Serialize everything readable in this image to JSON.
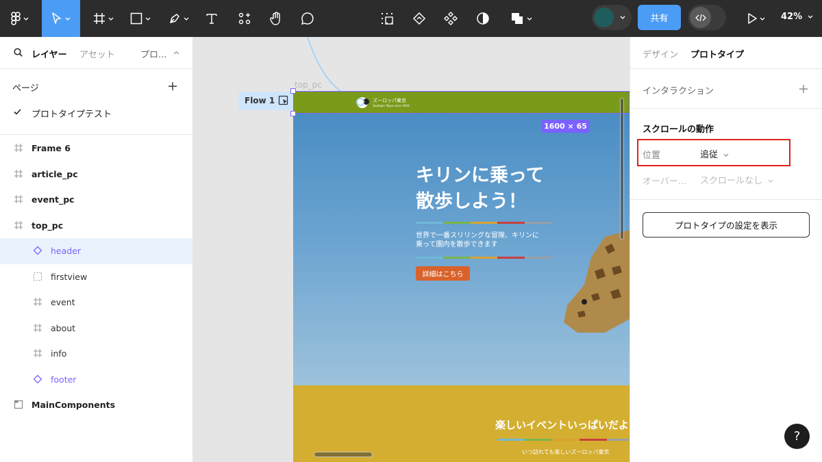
{
  "toolbar": {
    "share_label": "共有",
    "zoom_label": "42%"
  },
  "left_panel": {
    "tabs": {
      "layers": "レイヤー",
      "assets": "アセット",
      "proto": "プロ..."
    },
    "pages_label": "ページ",
    "current_page": "プロトタイプテスト",
    "layers": [
      {
        "label": "Frame 6",
        "icon": "frame-icon",
        "level": 0
      },
      {
        "label": "article_pc",
        "icon": "frame-icon",
        "level": 0
      },
      {
        "label": "event_pc",
        "icon": "frame-icon",
        "level": 0
      },
      {
        "label": "top_pc",
        "icon": "frame-icon",
        "level": 0
      },
      {
        "label": "header",
        "icon": "component-instance-icon",
        "level": 1,
        "selected": true
      },
      {
        "label": "firstview",
        "icon": "dashed-frame-icon",
        "level": 1
      },
      {
        "label": "event",
        "icon": "frame-icon",
        "level": 1
      },
      {
        "label": "about",
        "icon": "frame-icon",
        "level": 1
      },
      {
        "label": "info",
        "icon": "frame-icon",
        "level": 1
      },
      {
        "label": "footer",
        "icon": "component-instance-icon",
        "level": 1
      },
      {
        "label": "MainComponents",
        "icon": "section-icon",
        "level": 0
      }
    ]
  },
  "canvas": {
    "frame_label": "top_pc",
    "flow_label": "Flow 1",
    "size_badge": "1600 × 65",
    "site": {
      "logo_title": "ズーロッパ東京",
      "logo_sub": "Zootopia Tokyo since 19XX",
      "hero_title_line1": "キリンに乗って",
      "hero_title_line2": "散歩しよう！",
      "hero_text_line1": "世界で一番スリリングな冒険、キリンに",
      "hero_text_line2": "乗って園内を散歩できます",
      "hero_button": "詳細はこちら",
      "event_title": "楽しいイベントいっぱいだよ",
      "event_sub": "いつ訪れても楽しいズーロッパ東京"
    },
    "stripe_colors": [
      "#6fb8d8",
      "#7ab648",
      "#d9a233",
      "#c94040",
      "#9aa0a6"
    ]
  },
  "right_panel": {
    "tabs": {
      "design": "デザイン",
      "prototype": "プロトタイプ"
    },
    "interaction_label": "インタラクション",
    "scroll_section_title": "スクロールの動作",
    "position_label": "位置",
    "position_value": "追従",
    "overflow_label": "オーバー...",
    "overflow_value": "スクロールなし",
    "settings_button": "プロトタイプの設定を表示"
  },
  "colors": {
    "accent": "#4b9cf5",
    "selection": "#7b61ff",
    "highlight_box": "#e01e1e",
    "header_green": "#7a9a1a",
    "event_yellow": "#d4ae30",
    "hero_button": "#d9622b"
  }
}
